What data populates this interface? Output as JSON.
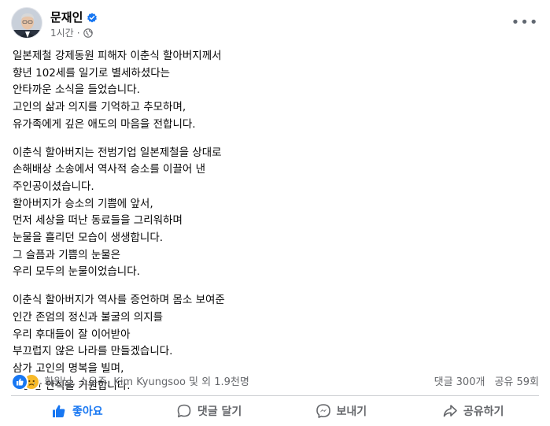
{
  "post": {
    "author": "문재인",
    "time": "1시간",
    "paragraphs": [
      [
        "일본제철 강제동원 피해자 이춘식 할아버지께서",
        "향년 102세를 일기로 별세하셨다는",
        "안타까운 소식을 들었습니다.",
        "고인의 삶과 의지를 기억하고 추모하며,",
        "유가족에게 깊은 애도의 마음을 전합니다."
      ],
      [
        "이춘식 할아버지는 전범기업 일본제철을 상대로",
        "손해배상 소송에서 역사적 승소를 이끌어 낸",
        "주인공이셨습니다.",
        "할아버지가 승소의 기쁨에 앞서,",
        "먼저 세상을 떠난 동료들을 그리워하며",
        "눈물을 흘리던 모습이 생생합니다.",
        "그 슬픔과 기쁨의 눈물은",
        "우리 모두의 눈물이었습니다."
      ],
      [
        "이춘식 할아버지가 역사를 증언하며 몸소 보여준",
        "인간 존엄의 정신과 불굴의 의지를",
        "우리 후대들이 잘 이어받아",
        "부끄럽지 않은 나라를 만들겠습니다.",
        "삼가 고인의 명복을 빌며,",
        "평안한 안식을 기원합니다."
      ]
    ]
  },
  "reactions": {
    "summary": "회원님, 소우주, Kim Kyungsoo 및 외 1.9천명",
    "comments": "댓글 300개",
    "shares": "공유 59회"
  },
  "actions": {
    "like": "좋아요",
    "comment": "댓글 달기",
    "send": "보내기",
    "share": "공유하기"
  },
  "colors": {
    "accent": "#1877f2",
    "muted": "#65676b",
    "sad": "#f7b928"
  },
  "icons": {
    "verified": "verified-badge-icon",
    "audience": "globe-icon",
    "more": "more-options-icon",
    "like": "thumbs-up-icon",
    "comment": "comment-bubble-icon",
    "send": "messenger-icon",
    "share": "share-arrow-icon"
  }
}
